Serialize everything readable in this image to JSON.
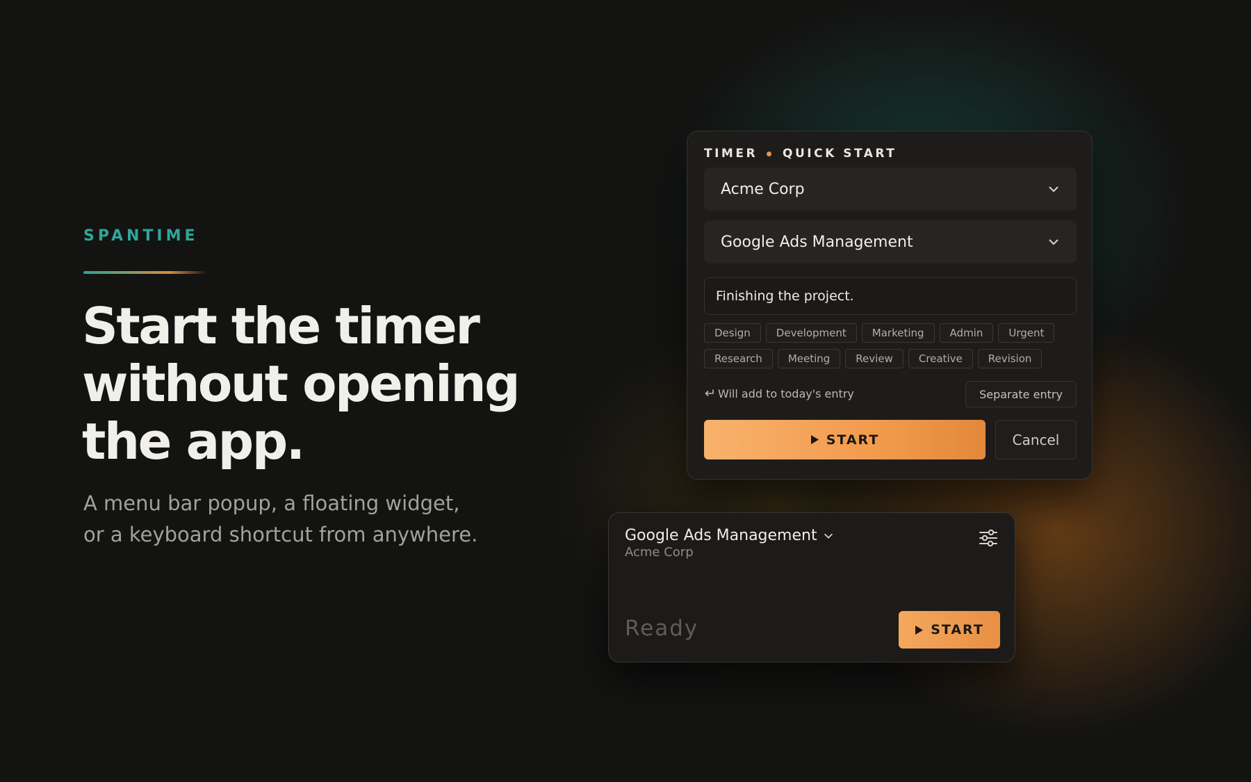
{
  "hero": {
    "brand": "SPANTIME",
    "headline_lines": [
      "Start the timer",
      "without opening",
      "the app."
    ],
    "subtitle_lines": [
      "A menu bar popup, a floating widget,",
      "or a keyboard shortcut from anywhere."
    ]
  },
  "quick_start": {
    "title_left": "TIMER",
    "title_right": "QUICK START",
    "client_select": {
      "selected": "Acme Corp",
      "icon": "chevron-down-icon"
    },
    "project_select": {
      "selected": "Google Ads Management",
      "icon": "chevron-down-icon"
    },
    "description": {
      "value": "Finishing the project.",
      "placeholder": ""
    },
    "tags": [
      "Design",
      "Development",
      "Marketing",
      "Admin",
      "Urgent",
      "Research",
      "Meeting",
      "Review",
      "Creative",
      "Revision"
    ],
    "merge_note": "Will add to today's entry",
    "merge_icon": "return-arrow-icon",
    "separate_label": "Separate entry",
    "start_label": "START",
    "start_icon": "play-icon",
    "cancel_label": "Cancel"
  },
  "widget": {
    "project": "Google Ads Management",
    "client": "Acme Corp",
    "settings_icon": "sliders-icon",
    "status": "Ready",
    "start_label": "START",
    "start_icon": "play-icon"
  },
  "colors": {
    "background": "#131312",
    "brand_teal": "#2ea799",
    "accent_orange": "#f29b4e",
    "panel": "#1d1c1a"
  }
}
